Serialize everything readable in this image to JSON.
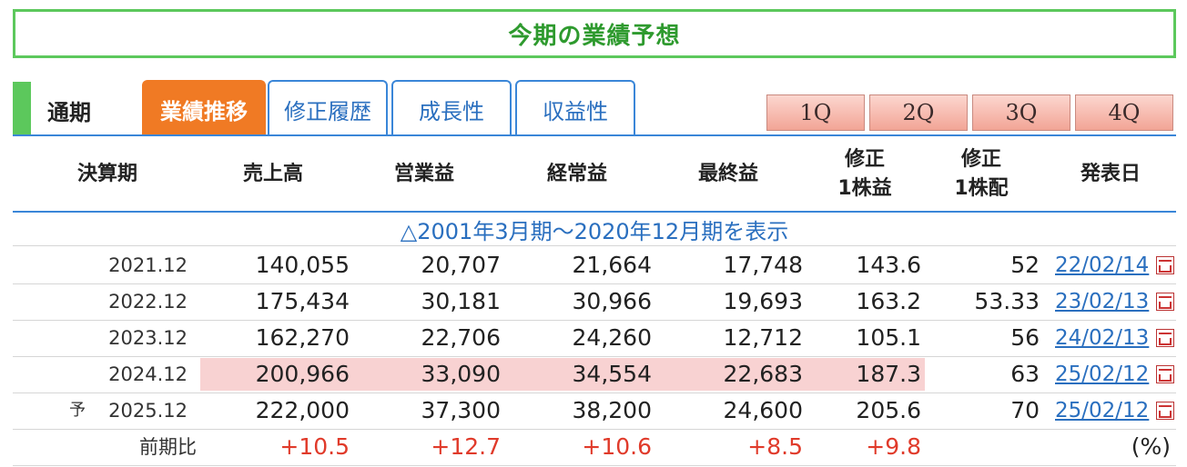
{
  "title": "今期の業績予想",
  "tabs": {
    "period_label": "通期",
    "items": [
      "業績推移",
      "修正履歴",
      "成長性",
      "収益性"
    ],
    "quarters": [
      "1Q",
      "2Q",
      "3Q",
      "4Q"
    ]
  },
  "headers": {
    "period": "決算期",
    "sales": "売上高",
    "op": "営業益",
    "ordinary": "経常益",
    "net": "最終益",
    "eps_l1": "修正",
    "eps_l2": "1株益",
    "div_l1": "修正",
    "div_l2": "1株配",
    "date": "発表日"
  },
  "expand_text": "△2001年3月期～2020年12月期を表示",
  "rows": [
    {
      "pred": "",
      "period": "2021.12",
      "sales": "140,055",
      "op": "20,707",
      "ordinary": "21,664",
      "net": "17,748",
      "eps": "143.6",
      "div": "52",
      "date": "22/02/14"
    },
    {
      "pred": "",
      "period": "2022.12",
      "sales": "175,434",
      "op": "30,181",
      "ordinary": "30,966",
      "net": "19,693",
      "eps": "163.2",
      "div": "53.33",
      "date": "23/02/13"
    },
    {
      "pred": "",
      "period": "2023.12",
      "sales": "162,270",
      "op": "22,706",
      "ordinary": "24,260",
      "net": "12,712",
      "eps": "105.1",
      "div": "56",
      "date": "24/02/13"
    },
    {
      "pred": "",
      "period": "2024.12",
      "sales": "200,966",
      "op": "33,090",
      "ordinary": "34,554",
      "net": "22,683",
      "eps": "187.3",
      "div": "63",
      "date": "25/02/12"
    },
    {
      "pred": "予",
      "period": "2025.12",
      "sales": "222,000",
      "op": "37,300",
      "ordinary": "38,200",
      "net": "24,600",
      "eps": "205.6",
      "div": "70",
      "date": "25/02/12"
    }
  ],
  "yoy": {
    "label": "前期比",
    "sales": "+10.5",
    "op": "+12.7",
    "ordinary": "+10.6",
    "net": "+8.5",
    "eps": "+9.8",
    "unit": "(%)"
  },
  "colors": {
    "title_green": "#2e9a2e",
    "active_tab_orange": "#f07a24",
    "tab_blue": "#2a6fbf",
    "highlight_pink": "#f8d2d2",
    "positive_red": "#e03a2a"
  },
  "icons": {
    "pdf": "pdf-icon"
  }
}
